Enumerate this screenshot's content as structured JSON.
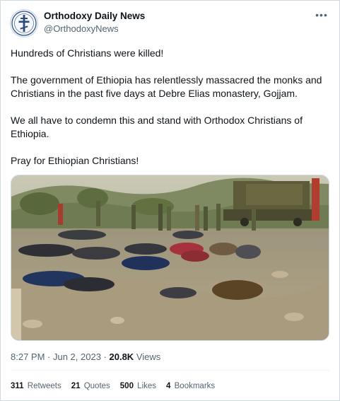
{
  "author": {
    "name": "Orthodoxy Daily News",
    "handle": "@OrthodoxyNews"
  },
  "more_icon": "more-horizontal-icon",
  "tweet": {
    "paragraphs": [
      "Hundreds of Christians were killed!",
      "The government of Ethiopia has relentlessly massacred the monks and Christians in the past five days at Debre Elias monastery, Gojjam.",
      "We all have to condemn this and stand with Orthodox Christians of Ethiopia.",
      "Pray for Ethiopian Christians!"
    ]
  },
  "meta": {
    "time": "8:27 PM",
    "sep": " · ",
    "date": "Jun 2, 2023",
    "views_count": "20.8K",
    "views_label": "Views"
  },
  "stats": {
    "retweets_count": "311",
    "retweets_label": "Retweets",
    "quotes_count": "21",
    "quotes_label": "Quotes",
    "likes_count": "500",
    "likes_label": "Likes",
    "bookmarks_count": "4",
    "bookmarks_label": "Bookmarks"
  },
  "colors": {
    "text": "#0f1419",
    "secondary": "#536471",
    "border": "#cfd9de"
  }
}
